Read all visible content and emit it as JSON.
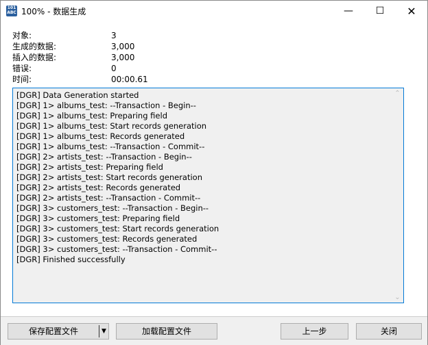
{
  "window": {
    "title": "100% - 数据生成",
    "icon": "database-101-icon"
  },
  "stats": [
    {
      "label": "对象:",
      "value": "3"
    },
    {
      "label": "生成的数据:",
      "value": "3,000"
    },
    {
      "label": "插入的数据:",
      "value": "3,000"
    },
    {
      "label": "错误:",
      "value": "0"
    },
    {
      "label": "时间:",
      "value": "00:00.61"
    }
  ],
  "log": [
    "[DGR] Data Generation started",
    "[DGR] 1> albums_test: --Transaction - Begin--",
    "[DGR] 1> albums_test: Preparing field",
    "[DGR] 1> albums_test: Start records generation",
    "[DGR] 1> albums_test: Records generated",
    "[DGR] 1> albums_test: --Transaction - Commit--",
    "[DGR] 2> artists_test: --Transaction - Begin--",
    "[DGR] 2> artists_test: Preparing field",
    "[DGR] 2> artists_test: Start records generation",
    "[DGR] 2> artists_test: Records generated",
    "[DGR] 2> artists_test: --Transaction - Commit--",
    "[DGR] 3> customers_test: --Transaction - Begin--",
    "[DGR] 3> customers_test: Preparing field",
    "[DGR] 3> customers_test: Start records generation",
    "[DGR] 3> customers_test: Records generated",
    "[DGR] 3> customers_test: --Transaction - Commit--",
    "[DGR] Finished successfully"
  ],
  "buttons": {
    "save": "保存配置文件",
    "load": "加载配置文件",
    "back": "上一步",
    "close": "关闭"
  }
}
